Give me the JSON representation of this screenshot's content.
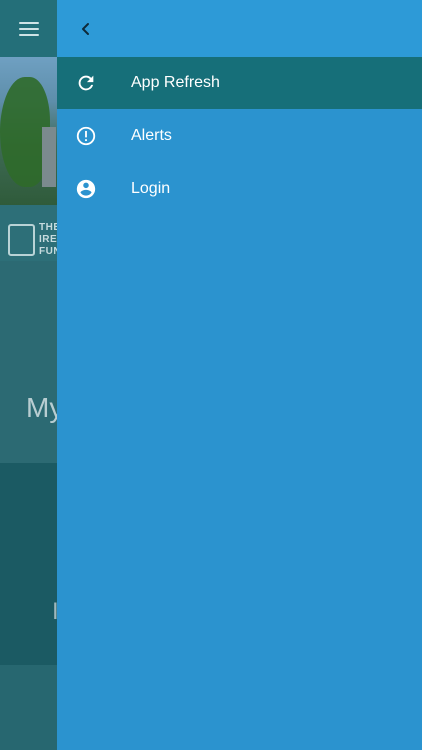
{
  "background": {
    "logo_lines": [
      "THE",
      "IRE",
      "FUN"
    ],
    "my_text": "My",
    "section2_text": "I"
  },
  "drawer": {
    "menu": [
      {
        "label": "App Refresh",
        "icon": "refresh-icon",
        "active": true
      },
      {
        "label": "Alerts",
        "icon": "alert-circle-icon",
        "active": false
      },
      {
        "label": "Login",
        "icon": "account-circle-icon",
        "active": false
      }
    ]
  },
  "colors": {
    "drawer_bg": "#2b93cf",
    "active_item_bg": "#166f79",
    "header_bg": "#2d9ad7"
  }
}
